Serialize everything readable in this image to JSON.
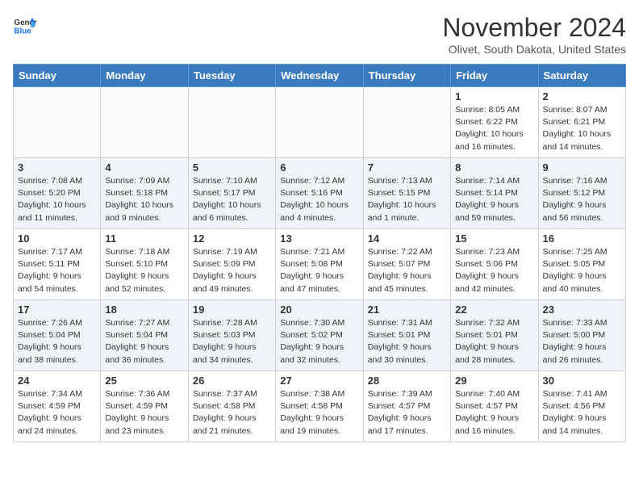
{
  "header": {
    "logo_general": "General",
    "logo_blue": "Blue",
    "month_title": "November 2024",
    "location": "Olivet, South Dakota, United States"
  },
  "days_of_week": [
    "Sunday",
    "Monday",
    "Tuesday",
    "Wednesday",
    "Thursday",
    "Friday",
    "Saturday"
  ],
  "weeks": [
    [
      {
        "day": "",
        "info": ""
      },
      {
        "day": "",
        "info": ""
      },
      {
        "day": "",
        "info": ""
      },
      {
        "day": "",
        "info": ""
      },
      {
        "day": "",
        "info": ""
      },
      {
        "day": "1",
        "info": "Sunrise: 8:05 AM\nSunset: 6:22 PM\nDaylight: 10 hours\nand 16 minutes."
      },
      {
        "day": "2",
        "info": "Sunrise: 8:07 AM\nSunset: 6:21 PM\nDaylight: 10 hours\nand 14 minutes."
      }
    ],
    [
      {
        "day": "3",
        "info": "Sunrise: 7:08 AM\nSunset: 5:20 PM\nDaylight: 10 hours\nand 11 minutes."
      },
      {
        "day": "4",
        "info": "Sunrise: 7:09 AM\nSunset: 5:18 PM\nDaylight: 10 hours\nand 9 minutes."
      },
      {
        "day": "5",
        "info": "Sunrise: 7:10 AM\nSunset: 5:17 PM\nDaylight: 10 hours\nand 6 minutes."
      },
      {
        "day": "6",
        "info": "Sunrise: 7:12 AM\nSunset: 5:16 PM\nDaylight: 10 hours\nand 4 minutes."
      },
      {
        "day": "7",
        "info": "Sunrise: 7:13 AM\nSunset: 5:15 PM\nDaylight: 10 hours\nand 1 minute."
      },
      {
        "day": "8",
        "info": "Sunrise: 7:14 AM\nSunset: 5:14 PM\nDaylight: 9 hours\nand 59 minutes."
      },
      {
        "day": "9",
        "info": "Sunrise: 7:16 AM\nSunset: 5:12 PM\nDaylight: 9 hours\nand 56 minutes."
      }
    ],
    [
      {
        "day": "10",
        "info": "Sunrise: 7:17 AM\nSunset: 5:11 PM\nDaylight: 9 hours\nand 54 minutes."
      },
      {
        "day": "11",
        "info": "Sunrise: 7:18 AM\nSunset: 5:10 PM\nDaylight: 9 hours\nand 52 minutes."
      },
      {
        "day": "12",
        "info": "Sunrise: 7:19 AM\nSunset: 5:09 PM\nDaylight: 9 hours\nand 49 minutes."
      },
      {
        "day": "13",
        "info": "Sunrise: 7:21 AM\nSunset: 5:08 PM\nDaylight: 9 hours\nand 47 minutes."
      },
      {
        "day": "14",
        "info": "Sunrise: 7:22 AM\nSunset: 5:07 PM\nDaylight: 9 hours\nand 45 minutes."
      },
      {
        "day": "15",
        "info": "Sunrise: 7:23 AM\nSunset: 5:06 PM\nDaylight: 9 hours\nand 42 minutes."
      },
      {
        "day": "16",
        "info": "Sunrise: 7:25 AM\nSunset: 5:05 PM\nDaylight: 9 hours\nand 40 minutes."
      }
    ],
    [
      {
        "day": "17",
        "info": "Sunrise: 7:26 AM\nSunset: 5:04 PM\nDaylight: 9 hours\nand 38 minutes."
      },
      {
        "day": "18",
        "info": "Sunrise: 7:27 AM\nSunset: 5:04 PM\nDaylight: 9 hours\nand 36 minutes."
      },
      {
        "day": "19",
        "info": "Sunrise: 7:28 AM\nSunset: 5:03 PM\nDaylight: 9 hours\nand 34 minutes."
      },
      {
        "day": "20",
        "info": "Sunrise: 7:30 AM\nSunset: 5:02 PM\nDaylight: 9 hours\nand 32 minutes."
      },
      {
        "day": "21",
        "info": "Sunrise: 7:31 AM\nSunset: 5:01 PM\nDaylight: 9 hours\nand 30 minutes."
      },
      {
        "day": "22",
        "info": "Sunrise: 7:32 AM\nSunset: 5:01 PM\nDaylight: 9 hours\nand 28 minutes."
      },
      {
        "day": "23",
        "info": "Sunrise: 7:33 AM\nSunset: 5:00 PM\nDaylight: 9 hours\nand 26 minutes."
      }
    ],
    [
      {
        "day": "24",
        "info": "Sunrise: 7:34 AM\nSunset: 4:59 PM\nDaylight: 9 hours\nand 24 minutes."
      },
      {
        "day": "25",
        "info": "Sunrise: 7:36 AM\nSunset: 4:59 PM\nDaylight: 9 hours\nand 23 minutes."
      },
      {
        "day": "26",
        "info": "Sunrise: 7:37 AM\nSunset: 4:58 PM\nDaylight: 9 hours\nand 21 minutes."
      },
      {
        "day": "27",
        "info": "Sunrise: 7:38 AM\nSunset: 4:58 PM\nDaylight: 9 hours\nand 19 minutes."
      },
      {
        "day": "28",
        "info": "Sunrise: 7:39 AM\nSunset: 4:57 PM\nDaylight: 9 hours\nand 17 minutes."
      },
      {
        "day": "29",
        "info": "Sunrise: 7:40 AM\nSunset: 4:57 PM\nDaylight: 9 hours\nand 16 minutes."
      },
      {
        "day": "30",
        "info": "Sunrise: 7:41 AM\nSunset: 4:56 PM\nDaylight: 9 hours\nand 14 minutes."
      }
    ]
  ],
  "row_classes": [
    "row-light",
    "row-dark",
    "row-light",
    "row-dark",
    "row-light"
  ]
}
